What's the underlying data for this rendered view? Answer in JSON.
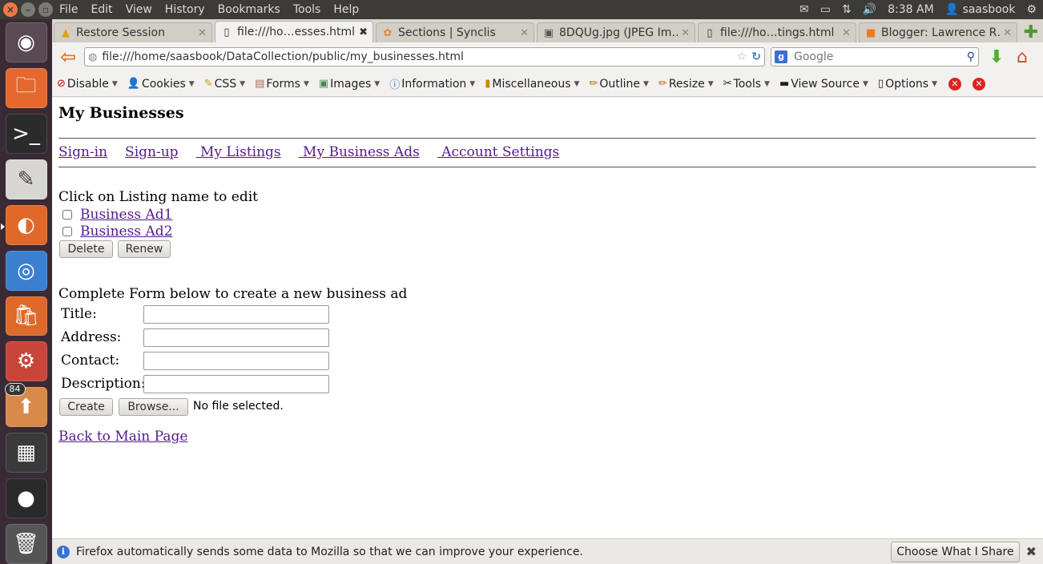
{
  "system_menu": {
    "items": [
      "File",
      "Edit",
      "View",
      "History",
      "Bookmarks",
      "Tools",
      "Help"
    ],
    "time": "8:38 AM",
    "user": "saasbook"
  },
  "launcher": {
    "badge_count": "84"
  },
  "tabs": [
    {
      "label": "Restore Session",
      "icon": "warning-icon",
      "selected": false
    },
    {
      "label": "file:///ho…esses.html",
      "icon": "blank-page-icon",
      "selected": true
    },
    {
      "label": "Sections | Synclis",
      "icon": "synclis-icon",
      "selected": false
    },
    {
      "label": "8DQUg.jpg (JPEG Im…",
      "icon": "image-icon",
      "selected": false
    },
    {
      "label": "file:///ho…tings.html",
      "icon": "blank-page-icon",
      "selected": false
    },
    {
      "label": "Blogger: Lawrence R…",
      "icon": "blogger-icon",
      "selected": false
    }
  ],
  "navbar": {
    "url": "file:///home/saasbook/DataCollection/public/my_businesses.html",
    "search_placeholder": "Google"
  },
  "dev_toolbar": {
    "items": [
      "Disable",
      "Cookies",
      "CSS",
      "Forms",
      "Images",
      "Information",
      "Miscellaneous",
      "Outline",
      "Resize",
      "Tools",
      "View Source",
      "Options"
    ]
  },
  "page": {
    "title": "My Businesses",
    "nav_links": [
      "Sign-in",
      "Sign-up",
      " My Listings",
      " My Business Ads",
      " Account Settings"
    ],
    "instruction": "Click on Listing name to edit",
    "listings": [
      "Business Ad1",
      "Business Ad2"
    ],
    "delete_label": "Delete",
    "renew_label": "Renew",
    "form_intro": "Complete Form below to create a new business ad",
    "form_labels": {
      "title": "Title:",
      "address": "Address:",
      "contact": "Contact:",
      "description": "Description:"
    },
    "create_label": "Create",
    "browse_label": "Browse...",
    "no_file_text": "No file selected.",
    "back_link": "Back to Main Page"
  },
  "notification": {
    "text": "Firefox automatically sends some data to Mozilla so that we can improve your experience.",
    "button_label": "Choose What I Share"
  }
}
